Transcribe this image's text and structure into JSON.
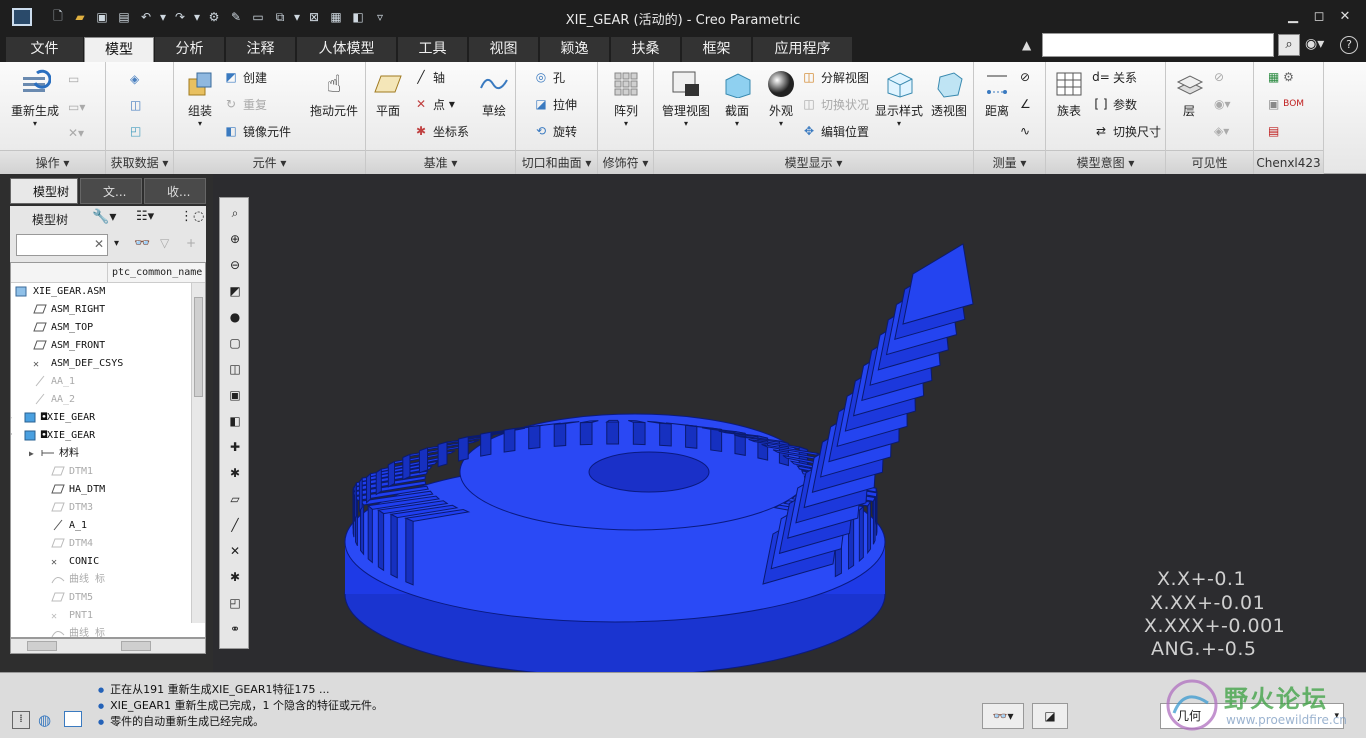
{
  "window": {
    "title": "XIE_GEAR (活动的) - Creo Parametric"
  },
  "tabs": [
    "文件",
    "模型",
    "分析",
    "注释",
    "人体模型",
    "工具",
    "视图",
    "颖逸",
    "扶桑",
    "框架",
    "应用程序"
  ],
  "ribbon": {
    "regenerate": "重新生成",
    "create": "创建",
    "redo_part": "重复",
    "mirror": "镜像元件",
    "assemble": "组装",
    "drag": "拖动元件",
    "plane": "平面",
    "axis": "轴",
    "point": "点",
    "csys": "坐标系",
    "sketch": "草绘",
    "hole": "孔",
    "extrude": "拉伸",
    "revolve": "旋转",
    "pattern": "阵列",
    "manage_views": "管理视图",
    "section": "截面",
    "appearance": "外观",
    "explode": "分解视图",
    "toggle_status": "切换状况",
    "edit_position": "编辑位置",
    "display_style": "显示样式",
    "perspective": "透视图",
    "distance": "距离",
    "family_table": "族表",
    "relations": "关系",
    "parameters": "参数",
    "switch_dims": "切换尺寸",
    "layers": "层",
    "groups": [
      "操作",
      "获取数据",
      "元件",
      "基准",
      "切口和曲面",
      "修饰符",
      "模型显示",
      "测量",
      "模型意图",
      "可见性",
      "Chenxl423"
    ]
  },
  "panel": {
    "tabs": [
      "模型树",
      "文...",
      "收..."
    ],
    "tree_label": "模型树",
    "column": "ptc_common_name",
    "rows": [
      {
        "t": "XIE_GEAR.ASM",
        "d": false
      },
      {
        "t": "ASM_RIGHT",
        "d": false
      },
      {
        "t": "ASM_TOP",
        "d": false
      },
      {
        "t": "ASM_FRONT",
        "d": false
      },
      {
        "t": "ASM_DEF_CSYS",
        "d": false
      },
      {
        "t": "AA_1",
        "d": true
      },
      {
        "t": "AA_2",
        "d": true
      },
      {
        "t": "◘XIE_GEAR",
        "d": false
      },
      {
        "t": "◘XIE_GEAR",
        "d": false
      },
      {
        "t": "材料",
        "d": false
      },
      {
        "t": "DTM1",
        "d": true
      },
      {
        "t": "HA_DTM",
        "d": false
      },
      {
        "t": "DTM3",
        "d": true
      },
      {
        "t": "A_1",
        "d": false
      },
      {
        "t": "DTM4",
        "d": true
      },
      {
        "t": "CONIC",
        "d": false
      },
      {
        "t": "曲线 标",
        "d": true
      },
      {
        "t": "DTM5",
        "d": true
      },
      {
        "t": "PNT1",
        "d": true
      },
      {
        "t": "曲线 标",
        "d": true
      },
      {
        "t": "DTM6",
        "d": true
      }
    ]
  },
  "tolerances": [
    "X.X+-0.1",
    "X.XX+-0.01",
    "X.XXX+-0.001",
    "ANG.+-0.5"
  ],
  "status": {
    "messages": [
      "正在从191 重新生成XIE_GEAR1特征175 ...",
      "XIE_GEAR1 重新生成已完成，1 个隐含的特征或元件。",
      "零件的自动重新生成已经完成。"
    ],
    "filter": "几何",
    "watermark": "野火论坛",
    "watermark_url": "www.proewildfire.cn"
  },
  "colors": {
    "gear": "#1f3ef0",
    "canvas": "#2c2c2f",
    "accent": "#2462b8"
  }
}
